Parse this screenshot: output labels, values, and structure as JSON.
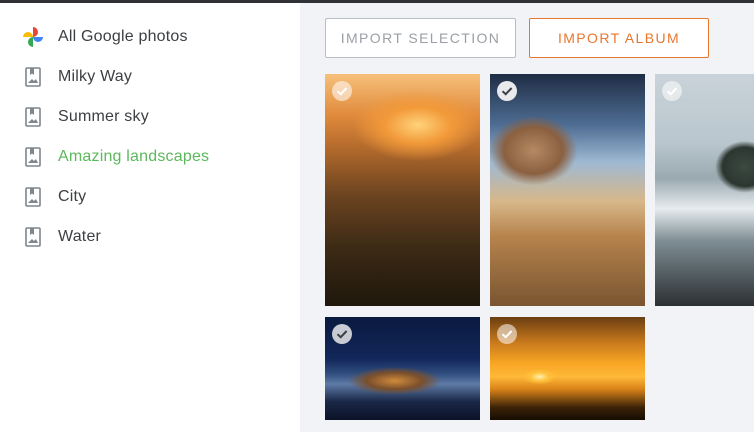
{
  "sidebar": {
    "items": [
      {
        "label": "All Google photos",
        "icon": "google-photos-icon",
        "active": false
      },
      {
        "label": "Milky Way",
        "icon": "album-icon",
        "active": false
      },
      {
        "label": "Summer sky",
        "icon": "album-icon",
        "active": false
      },
      {
        "label": "Amazing landscapes",
        "icon": "album-icon",
        "active": true
      },
      {
        "label": "City",
        "icon": "album-icon",
        "active": false
      },
      {
        "label": "Water",
        "icon": "album-icon",
        "active": false
      }
    ]
  },
  "toolbar": {
    "import_selection_label": "IMPORT SELECTION",
    "import_album_label": "IMPORT ALBUM"
  },
  "colors": {
    "accent_orange": "#e8772e",
    "active_green": "#5cb85c",
    "main_background": "#f1f3f6"
  },
  "photos": [
    {
      "subject": "sunrise over foggy valley",
      "selected": true
    },
    {
      "subject": "balanced rock under blue sky",
      "selected": true
    },
    {
      "subject": "sea stack on misty coast",
      "selected": true
    },
    {
      "subject": "snowy village at night",
      "selected": true
    },
    {
      "subject": "sunset with reeds over water",
      "selected": true
    }
  ]
}
